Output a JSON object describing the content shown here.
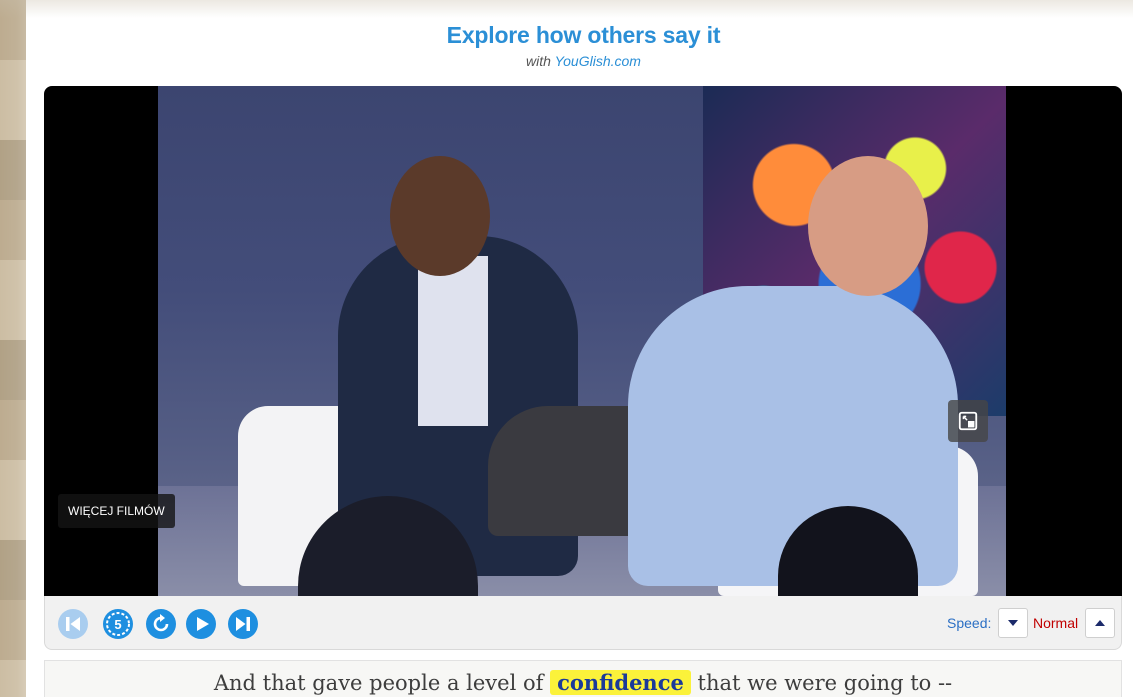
{
  "heading": {
    "title": "Explore how others say it",
    "with_text": "with ",
    "brand": "YouGlish.com"
  },
  "player": {
    "more_videos_label": "WIĘCEJ FILMÓW",
    "pip_icon": "picture-in-picture-icon"
  },
  "controls": {
    "buttons": [
      {
        "name": "previous-button",
        "icon": "skip-previous-icon",
        "enabled": false
      },
      {
        "name": "replay-slow-button",
        "icon": "replay-slow-icon",
        "enabled": true
      },
      {
        "name": "replay-button",
        "icon": "replay-icon",
        "enabled": true
      },
      {
        "name": "play-button",
        "icon": "play-icon",
        "enabled": true
      },
      {
        "name": "next-button",
        "icon": "skip-next-icon",
        "enabled": true
      }
    ],
    "speed_label": "Speed:",
    "speed_value": "Normal"
  },
  "caption": {
    "before": "And that gave people a level of ",
    "highlight": "confidence",
    "after": " that we were going to --"
  },
  "colors": {
    "accent": "#2b8fd6",
    "control_blue": "#1e8fe0",
    "speed_value": "#c00000",
    "highlight": "#fbf23a"
  }
}
